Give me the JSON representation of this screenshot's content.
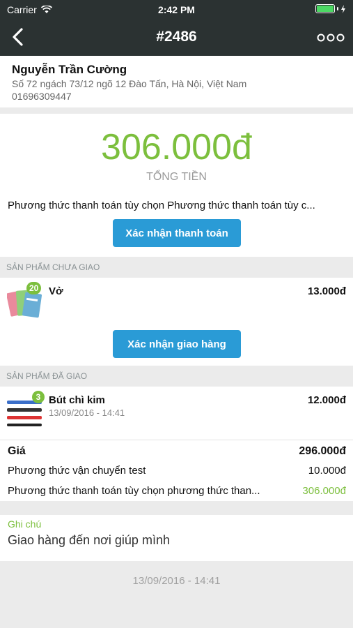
{
  "status_bar": {
    "carrier": "Carrier",
    "time": "2:42 PM",
    "battery_level": 1.0
  },
  "nav": {
    "title": "#2486",
    "back_icon": "chevron-left-icon",
    "more_icon": "ellipsis-icon"
  },
  "customer": {
    "name": "Nguyễn Trần Cường",
    "address": "Số 72 ngách 73/12 ngõ 12 Đào Tấn, Hà Nội, Việt Nam",
    "phone": "01696309447"
  },
  "total": {
    "amount": "306.000đ",
    "label": "TỔNG TIỀN",
    "payment_method": "Phương thức thanh toán tùy chọn Phương thức thanh toán tùy c...",
    "confirm_payment_label": "Xác nhận thanh toán"
  },
  "undelivered": {
    "header": "SẢN PHẨM CHƯA GIAO",
    "items": [
      {
        "name": "Vở",
        "price": "13.000đ",
        "qty": "20"
      }
    ],
    "confirm_delivery_label": "Xác nhận giao hàng"
  },
  "delivered": {
    "header": "SẢN PHẨM ĐÃ GIAO",
    "items": [
      {
        "name": "Bút chì kim",
        "date": "13/09/2016 - 14:41",
        "price": "12.000đ",
        "qty": "3"
      }
    ]
  },
  "summary": {
    "price_label": "Giá",
    "price_value": "296.000đ",
    "shipping_label": "Phương thức vận chuyển test",
    "shipping_value": "10.000đ",
    "payment_label": "Phương thức thanh toán tùy chọn phương thức than...",
    "payment_value": "306.000đ"
  },
  "note": {
    "label": "Ghi chú",
    "text": "Giao hàng đến nơi giúp mình"
  },
  "footer": {
    "date": "13/09/2016 - 14:41"
  },
  "colors": {
    "nav_bg": "#2b3232",
    "accent_green": "#7cbf3d",
    "button_blue": "#2a9bd6"
  }
}
